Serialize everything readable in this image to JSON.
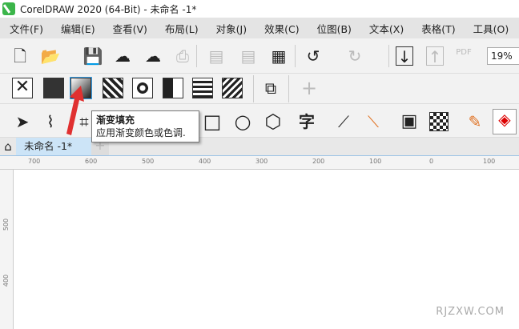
{
  "window": {
    "title": "CorelDRAW 2020 (64-Bit) - 未命名 -1*"
  },
  "menu": [
    "文件(F)",
    "编辑(E)",
    "查看(V)",
    "布局(L)",
    "对象(J)",
    "效果(C)",
    "位图(B)",
    "文本(X)",
    "表格(T)",
    "工具(O)"
  ],
  "toolbar": {
    "zoom_value": "19%",
    "pdf_label": "PDF"
  },
  "tooltip": {
    "title": "渐变填充",
    "description": "应用渐变颜色或色调."
  },
  "toolbox": {
    "text_tool_glyph": "字"
  },
  "document_tab": {
    "label": "未命名 -1*"
  },
  "ruler": {
    "horizontal": [
      "700",
      "600",
      "500",
      "400",
      "300",
      "200",
      "100",
      "0",
      "100"
    ],
    "vertical": [
      "500",
      "400"
    ]
  },
  "watermark": "RJZXW.COM",
  "colors": {
    "accent": "#e03030",
    "tab": "#cce4f7"
  }
}
